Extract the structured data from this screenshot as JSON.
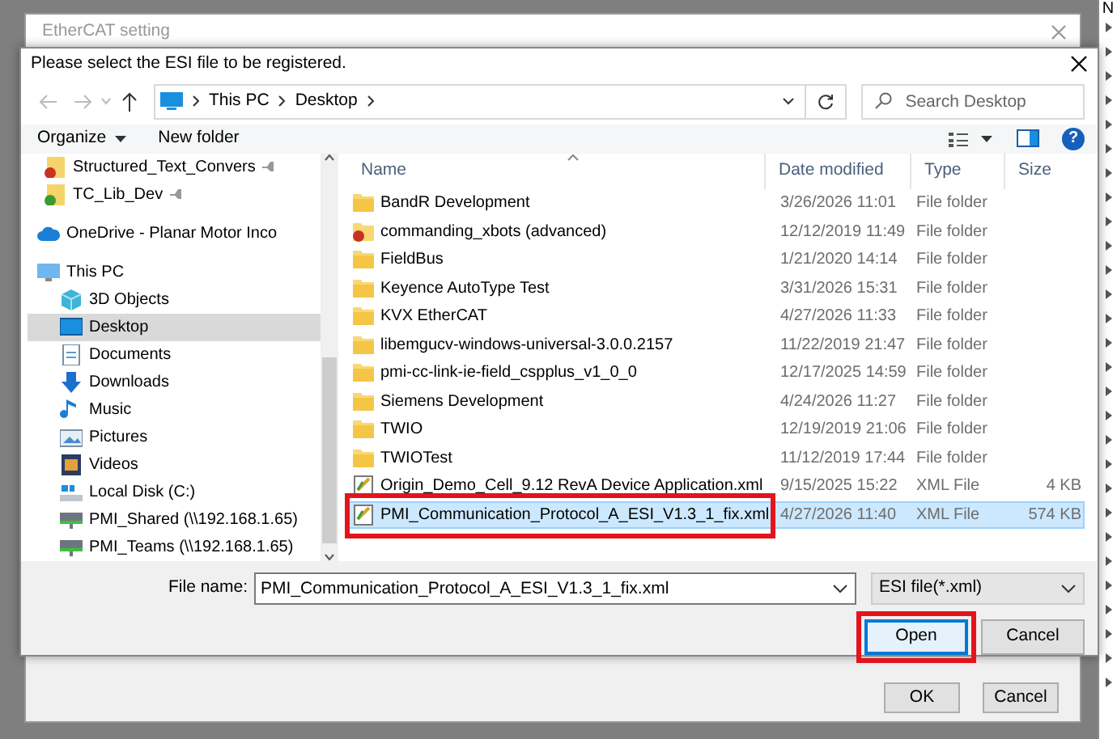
{
  "background_window": {
    "title": "EtherCAT setting",
    "buttons": [
      "OK",
      "Cancel"
    ]
  },
  "edge_text": "N",
  "dialog": {
    "title": "Please select the ESI file to be registered.",
    "breadcrumb": [
      "This PC",
      "Desktop"
    ],
    "search": {
      "placeholder": "Search Desktop"
    },
    "help_symbol": "?",
    "toolbar": [
      {
        "label": "Organize",
        "kind": "menu"
      },
      {
        "label": "New folder",
        "kind": "plain"
      }
    ],
    "nav_items": [
      {
        "label": "Structured_Text_Convers",
        "kind": "doc-alert",
        "pinned": true,
        "selected": false
      },
      {
        "label": "TC_Lib_Dev",
        "kind": "doc-ok",
        "pinned": true,
        "selected": false
      },
      {
        "label": "OneDrive - Planar Motor Inco",
        "kind": "cloud",
        "pinned": false,
        "selected": false
      },
      {
        "label": "This PC",
        "kind": "pc",
        "pinned": false,
        "selected": false,
        "children": [
          {
            "label": "3D Objects",
            "kind": "cube",
            "pinned": false,
            "selected": false
          },
          {
            "label": "Desktop",
            "kind": "desktop",
            "pinned": false,
            "selected": true
          },
          {
            "label": "Documents",
            "kind": "document",
            "pinned": false,
            "selected": false
          },
          {
            "label": "Downloads",
            "kind": "download",
            "pinned": false,
            "selected": false
          },
          {
            "label": "Music",
            "kind": "music",
            "pinned": false,
            "selected": false
          },
          {
            "label": "Pictures",
            "kind": "picture",
            "pinned": false,
            "selected": false
          },
          {
            "label": "Videos",
            "kind": "video",
            "pinned": false,
            "selected": false
          },
          {
            "label": "Local Disk (C:)",
            "kind": "disk",
            "pinned": false,
            "selected": false
          },
          {
            "label": "PMI_Shared (\\\\192.168.1.65)",
            "kind": "network",
            "pinned": false,
            "selected": false
          },
          {
            "label": "PMI_Teams (\\\\192.168.1.65)",
            "kind": "network",
            "pinned": false,
            "selected": false
          }
        ]
      }
    ],
    "columns": [
      "Name",
      "Date modified",
      "Type",
      "Size"
    ],
    "files": [
      {
        "name": "BandR Development",
        "date": "3/26/2026 11:01",
        "type": "File folder",
        "kind": "folder",
        "selected": false,
        "highlighted": false
      },
      {
        "name": "commanding_xbots (advanced)",
        "date": "12/12/2019 11:49",
        "type": "File folder",
        "kind": "folder-alert",
        "selected": false,
        "highlighted": false
      },
      {
        "name": "FieldBus",
        "date": "1/21/2020 14:14",
        "type": "File folder",
        "kind": "folder",
        "selected": false,
        "highlighted": false
      },
      {
        "name": "Keyence AutoType Test",
        "date": "3/31/2026 15:31",
        "type": "File folder",
        "kind": "folder",
        "selected": false,
        "highlighted": false
      },
      {
        "name": "KVX EtherCAT",
        "date": "4/27/2026 11:33",
        "type": "File folder",
        "kind": "folder",
        "selected": false,
        "highlighted": false
      },
      {
        "name": "libemgucv-windows-universal-3.0.0.2157",
        "date": "11/22/2019 21:47",
        "type": "File folder",
        "kind": "folder",
        "selected": false,
        "highlighted": false
      },
      {
        "name": "pmi-cc-link-ie-field_cspplus_v1_0_0",
        "date": "12/17/2025 14:59",
        "type": "File folder",
        "kind": "folder",
        "selected": false,
        "highlighted": false
      },
      {
        "name": "Siemens Development",
        "date": "4/24/2026 11:27",
        "type": "File folder",
        "kind": "folder",
        "selected": false,
        "highlighted": false
      },
      {
        "name": "TWIO",
        "date": "12/19/2019 21:06",
        "type": "File folder",
        "kind": "folder",
        "selected": false,
        "highlighted": false
      },
      {
        "name": "TWIOTest",
        "date": "11/12/2019 17:44",
        "type": "File folder",
        "kind": "folder",
        "selected": false,
        "highlighted": false
      },
      {
        "name": "Origin_Demo_Cell_9.12 RevA Device Application.xml",
        "date": "9/15/2025 15:22",
        "type": "XML File",
        "size": "4 KB",
        "kind": "xml",
        "selected": false,
        "highlighted": false
      },
      {
        "name": "PMI_Communication_Protocol_A_ESI_V1.3_1_fix.xml",
        "date": "4/27/2026 11:40",
        "type": "XML File",
        "size": "574 KB",
        "kind": "xml",
        "selected": true,
        "highlighted": true
      }
    ],
    "file_name_label": "File name:",
    "file_name": "PMI_Communication_Protocol_A_ESI_V1.3_1_fix.xml",
    "file_type": "ESI file(*.xml)",
    "buttons": [
      {
        "label": "Open",
        "highlighted": true
      },
      {
        "label": "Cancel",
        "highlighted": false
      }
    ]
  }
}
